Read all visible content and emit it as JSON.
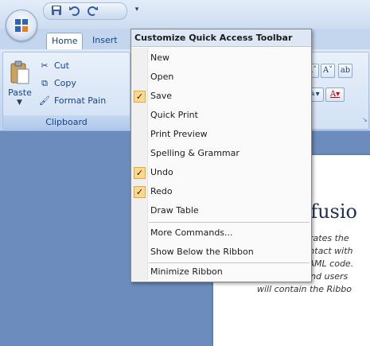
{
  "ribbon": {
    "tabs": [
      {
        "label": "Home"
      },
      {
        "label": "Insert"
      }
    ],
    "clipboard": {
      "paste_label": "Paste",
      "cut_label": "Cut",
      "copy_label": "Copy",
      "format_painter_label": "Format Pain",
      "group_label": "Clipboard"
    }
  },
  "menu": {
    "title": "Customize Quick Access Toolbar",
    "items": [
      {
        "label": "New",
        "checked": false
      },
      {
        "label": "Open",
        "checked": false
      },
      {
        "label": "Save",
        "checked": true
      },
      {
        "label": "Quick Print",
        "checked": false
      },
      {
        "label": "Print Preview",
        "checked": false
      },
      {
        "label": "Spelling & Grammar",
        "checked": false
      },
      {
        "label": "Undo",
        "checked": true
      },
      {
        "label": "Redo",
        "checked": true
      },
      {
        "label": "Draw Table",
        "checked": false
      }
    ],
    "more_commands": "More Commands...",
    "show_below": "Show Below the Ribbon",
    "minimize": "Minimize Ribbon"
  },
  "document": {
    "title_fragment": "efusio",
    "lines": [
      "ustrates the",
      "s intact with",
      "XAML code.",
      "allow your end users",
      "will contain the Ribbo"
    ]
  },
  "icons": {
    "qat": [
      "save-icon",
      "undo-icon",
      "redo-icon",
      "dropdown-icon"
    ],
    "checkmark": "check-icon"
  },
  "colors": {
    "ribbon_bg": "#c7d9f1",
    "workspace_bg": "#6b8cbc",
    "menu_header_bg": "#dde7f5",
    "check_highlight": "#fcd98e",
    "text": "#15428b"
  }
}
